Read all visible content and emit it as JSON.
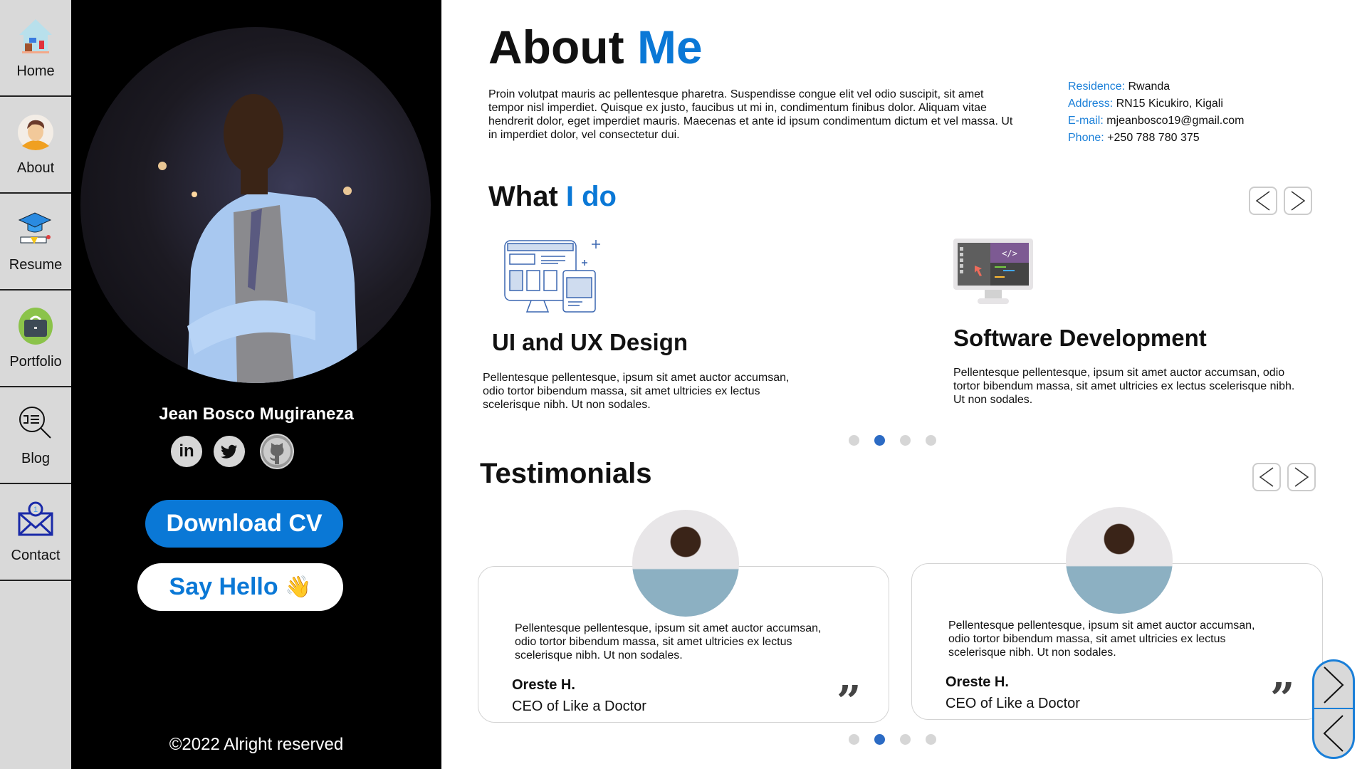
{
  "sidebar": {
    "items": [
      {
        "label": "Home",
        "icon": "home-icon"
      },
      {
        "label": "About",
        "icon": "user-avatar-icon"
      },
      {
        "label": "Resume",
        "icon": "graduation-cap-icon"
      },
      {
        "label": "Portfolio",
        "icon": "briefcase-icon"
      },
      {
        "label": "Blog",
        "icon": "search-list-icon"
      },
      {
        "label": "Contact",
        "icon": "mail-notification-icon"
      }
    ]
  },
  "profile": {
    "name": "Jean Bosco Mugiraneza",
    "social": [
      {
        "icon": "linkedin-icon",
        "glyph": "in"
      },
      {
        "icon": "twitter-icon"
      },
      {
        "icon": "github-icon"
      }
    ],
    "download_label": "Download CV",
    "hello_label": "Say Hello",
    "hello_emoji": "👋",
    "footer": "©2022 Alright reserved"
  },
  "about": {
    "title_a": "About ",
    "title_b": "Me",
    "text": "Proin volutpat mauris ac pellentesque pharetra. Suspendisse congue elit vel odio suscipit, sit amet tempor nisl imperdiet. Quisque ex justo, faucibus ut mi in, condimentum finibus dolor. Aliquam vitae hendrerit dolor, eget imperdiet mauris. Maecenas et ante id ipsum condimentum dictum et vel massa. Ut in imperdiet dolor, vel consectetur dui.",
    "info": [
      {
        "key": "Residence:",
        "value": "Rwanda"
      },
      {
        "key": "Address:",
        "value": "RN15 Kicukiro, Kigali"
      },
      {
        "key": "E-mail:",
        "value": "mjeanbosco19@gmail.com"
      },
      {
        "key": "Phone:",
        "value": "+250 788 780 375"
      }
    ]
  },
  "services": {
    "title_a": "What ",
    "title_b": "I do",
    "items": [
      {
        "title": "UI and UX Design",
        "text": "Pellentesque pellentesque, ipsum sit amet auctor accumsan, odio tortor bibendum massa, sit amet ultricies ex lectus scelerisque nibh. Ut non sodales."
      },
      {
        "title": "Software Development",
        "text": "Pellentesque pellentesque, ipsum sit amet auctor accumsan, odio tortor bibendum massa, sit amet ultricies ex lectus scelerisque nibh. Ut non sodales."
      }
    ],
    "active_dot": 1,
    "dot_count": 4
  },
  "testimonials": {
    "title": "Testimonials",
    "items": [
      {
        "text": "Pellentesque pellentesque, ipsum sit amet auctor accumsan, odio tortor bibendum massa, sit amet ultricies ex lectus scelerisque nibh. Ut non sodales.",
        "name": "Oreste H.",
        "role": "CEO of Like a Doctor"
      },
      {
        "text": "Pellentesque pellentesque, ipsum sit amet auctor accumsan, odio tortor bibendum massa, sit amet ultricies ex lectus scelerisque nibh. Ut non sodales.",
        "name": "Oreste H.",
        "role": "CEO of Like a Doctor"
      }
    ],
    "quote_glyph": "”",
    "active_dot": 1,
    "dot_count": 4
  },
  "colors": {
    "accent": "#0a78d6",
    "sidebar": "#d9d9d9",
    "panel": "#000000"
  }
}
